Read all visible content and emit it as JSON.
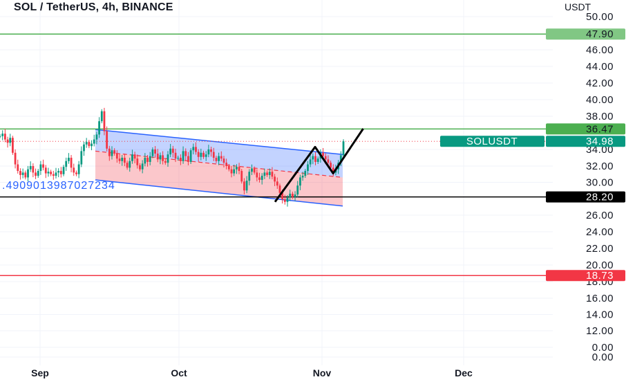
{
  "chart_data": {
    "type": "candlestick",
    "title": "SOL / TetherUS, 4h, BINANCE",
    "y_unit": "USDT",
    "ylim": [
      0,
      51
    ],
    "y_ticks": [
      {
        "label": "50.00",
        "value": 50
      },
      {
        "label": "46.00",
        "value": 46
      },
      {
        "label": "44.00",
        "value": 44
      },
      {
        "label": "42.00",
        "value": 42
      },
      {
        "label": "40.00",
        "value": 40
      },
      {
        "label": "38.00",
        "value": 38
      },
      {
        "label": "34.00",
        "value": 34
      },
      {
        "label": "32.00",
        "value": 32
      },
      {
        "label": "30.00",
        "value": 30
      },
      {
        "label": "26.00",
        "value": 26
      },
      {
        "label": "24.00",
        "value": 24
      },
      {
        "label": "22.00",
        "value": 22
      },
      {
        "label": "20.00",
        "value": 20
      },
      {
        "label": "18.00",
        "value": 18
      },
      {
        "label": "16.00",
        "value": 16
      },
      {
        "label": "14.00",
        "value": 14
      },
      {
        "label": "12.00",
        "value": 12
      },
      {
        "label": "0.00",
        "value": 0
      },
      {
        "label": "0.00",
        "value": 0
      }
    ],
    "x_ticks": [
      "Sep",
      "Oct",
      "Nov",
      "Dec"
    ],
    "horizontal_levels": [
      {
        "label": "47.90",
        "value": 47.9,
        "color": "#4caf50",
        "label_bg": "#81c784",
        "label_color": "#131722"
      },
      {
        "label": "36.47",
        "value": 36.47,
        "color": "#4caf50",
        "label_bg": "#4caf50",
        "label_color": "#131722"
      },
      {
        "label": "28.20",
        "value": 28.2,
        "color": "#000000",
        "label_bg": "#000000",
        "label_color": "#ffffff"
      },
      {
        "label": "18.73",
        "value": 18.73,
        "color": "#f23645",
        "label_bg": "#f23645",
        "label_color": "#ffffff"
      }
    ],
    "last_price": {
      "symbol": "SOLUSDT",
      "label": "34.98",
      "value": 34.98,
      "color": "#089981"
    },
    "regression_channel_label": ".4909013987027234",
    "series": [
      {
        "name": "SOLUSDT",
        "values": [
          35.6,
          35.9,
          35.2,
          34.8,
          35.4,
          33.6,
          32.2,
          31.4,
          30.9,
          31.2,
          30.6,
          31.6,
          32.0,
          31.2,
          30.8,
          31.4,
          32.2,
          31.8,
          31.1,
          31.3,
          31.0,
          30.8,
          31.2,
          31.4,
          31.0,
          31.9,
          32.6,
          33.0,
          31.8,
          31.2,
          31.0,
          32.2,
          33.8,
          34.6,
          34.9,
          34.4,
          34.7,
          35.2,
          35.8,
          37.4,
          38.6,
          36.2,
          34.1,
          33.2,
          33.9,
          33.5,
          32.9,
          32.6,
          33.0,
          32.4,
          31.8,
          32.6,
          33.4,
          32.9,
          32.1,
          31.6,
          32.3,
          33.0,
          32.5,
          33.2,
          34.0,
          33.5,
          32.8,
          33.3,
          32.6,
          32.4,
          33.4,
          34.1,
          33.6,
          32.9,
          33.0,
          32.6,
          33.8,
          33.2,
          32.5,
          33.9,
          34.3,
          33.7,
          33.1,
          33.6,
          33.1,
          33.4,
          34.0,
          33.7,
          33.0,
          32.6,
          33.2,
          32.9,
          32.4,
          32.0,
          31.6,
          31.1,
          31.6,
          31.9,
          31.4,
          30.1,
          29.0,
          30.2,
          31.3,
          31.7,
          31.2,
          30.6,
          30.3,
          30.8,
          31.2,
          30.9,
          31.3,
          30.7,
          30.1,
          29.6,
          28.7,
          27.9,
          27.6,
          28.1,
          28.6,
          28.2,
          28.5,
          29.6,
          30.6,
          30.8,
          31.4,
          32.2,
          32.8,
          33.2,
          32.5,
          32.9,
          33.6,
          33.2,
          32.8,
          32.4,
          31.8,
          31.2,
          31.6,
          32.4,
          33.3,
          34.98
        ]
      }
    ],
    "annotation_path": [
      [
        0.0,
        27.6
      ],
      [
        1.0,
        34.3
      ],
      [
        1.45,
        31.1
      ],
      [
        2.2,
        36.5
      ]
    ]
  }
}
